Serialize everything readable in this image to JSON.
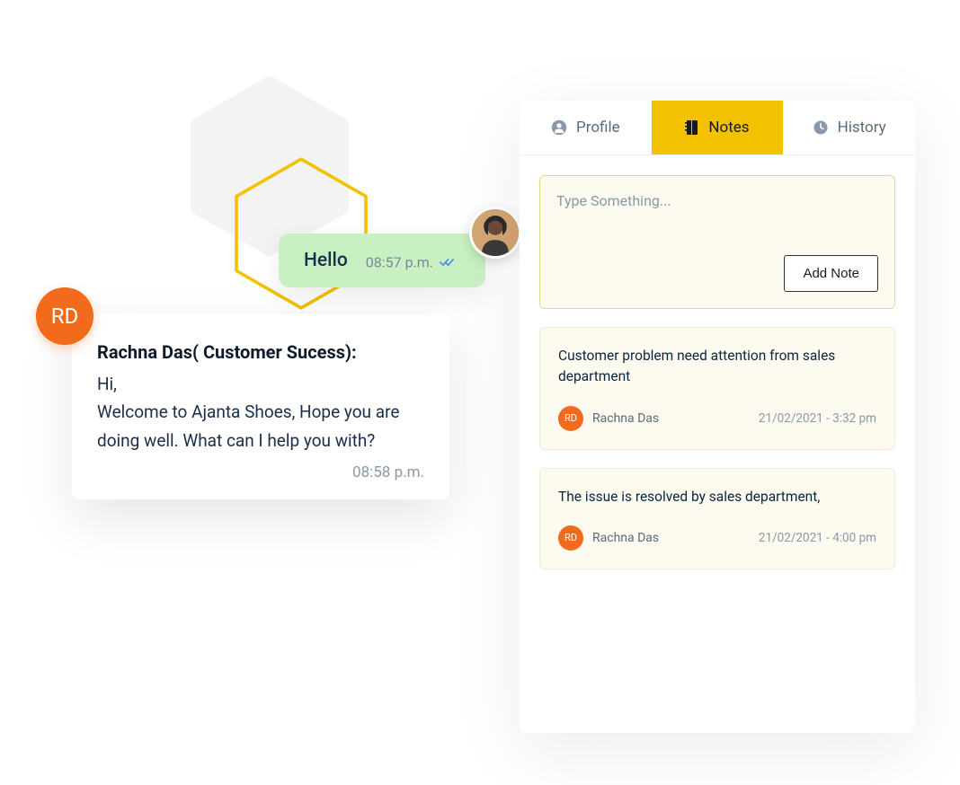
{
  "chat": {
    "incoming": {
      "text": "Hello",
      "time": "08:57 p.m.",
      "avatar_alt": "user-photo"
    },
    "outgoing": {
      "avatar_initials": "RD",
      "sender": "Rachna Das( Customer Sucess):",
      "body": "Hi,\nWelcome to Ajanta Shoes, Hope you are doing well. What can I help you with?",
      "time": "08:58 p.m."
    }
  },
  "panel": {
    "tabs": {
      "profile": "Profile",
      "notes": "Notes",
      "history": "History"
    },
    "compose": {
      "placeholder": "Type Something...",
      "button": "Add Note"
    },
    "notes": [
      {
        "text": "Customer problem need attention from sales department",
        "author_initials": "RD",
        "author_name": "Rachna Das",
        "timestamp": "21/02/2021 - 3:32 pm"
      },
      {
        "text": "The issue is resolved by sales department,",
        "author_initials": "RD",
        "author_name": "Rachna Das",
        "timestamp": "21/02/2021 - 4:00 pm"
      }
    ]
  }
}
